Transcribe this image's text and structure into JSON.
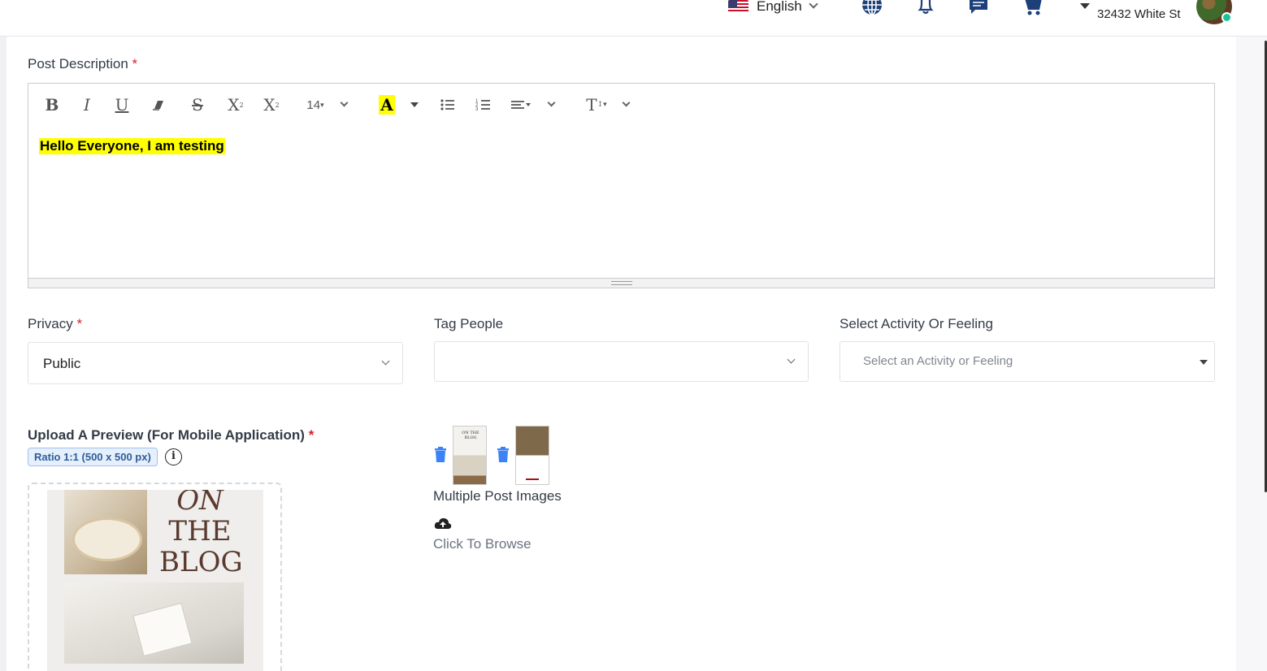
{
  "header": {
    "language": "English",
    "user_address": "32432 White St",
    "icons": [
      "globe-icon",
      "bell-icon",
      "chat-icon",
      "cart-icon"
    ]
  },
  "post_description": {
    "label": "Post Description",
    "required_mark": "*",
    "toolbar": {
      "bold": "B",
      "italic": "I",
      "underline": "U",
      "strikethrough": "S",
      "superscript": "X",
      "subscript": "X",
      "font_size": "14",
      "highlight": "A",
      "text_style": "T"
    },
    "content": "Hello Everyone, I am testing",
    "highlight_color": "#ffff00"
  },
  "privacy": {
    "label": "Privacy",
    "required_mark": "*",
    "value": "Public"
  },
  "tag_people": {
    "label": "Tag People",
    "value": ""
  },
  "activity": {
    "label": "Select Activity Or Feeling",
    "placeholder": "Select an Activity or Feeling"
  },
  "upload_preview": {
    "title": "Upload A Preview (For Mobile Application)",
    "required_mark": "*",
    "ratio_badge": "Ratio 1:1 (500 x 500 px)",
    "info": "i",
    "preview_text_lines": [
      "ON",
      "THE",
      "BLOG"
    ]
  },
  "multiple_images": {
    "label": "Multiple Post Images",
    "browse_label": "Click To Browse",
    "thumbnails": [
      "ON THE BLOG",
      "Blog post image"
    ]
  },
  "colors": {
    "accent": "#1d3f7a",
    "required": "#d3232f",
    "trash": "#3b82f6",
    "online": "#19c39a"
  }
}
